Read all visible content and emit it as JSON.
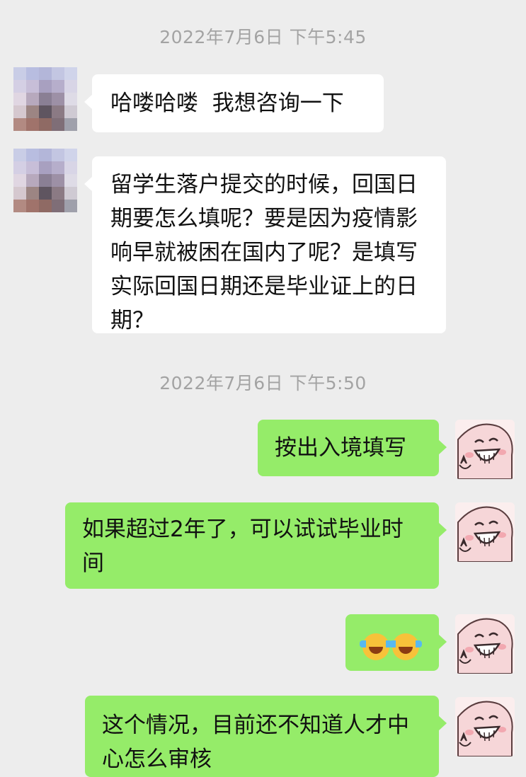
{
  "chat": {
    "timestamps": [
      "2022年7月6日 下午5:45",
      "2022年7月6日 下午5:50"
    ],
    "messages": [
      {
        "from": "contact",
        "text": "哈喽哈喽  我想咨询一下"
      },
      {
        "from": "contact",
        "text": "留学生落户提交的时候，回国日期要怎么填呢？要是因为疫情影响早就被困在国内了呢？是填写实际回国日期还是毕业证上的日期？"
      },
      {
        "from": "me",
        "text": "按出入境填写"
      },
      {
        "from": "me",
        "text": "如果超过2年了，可以试试毕业时间"
      },
      {
        "from": "me",
        "emoji": [
          "loudly-crying-face-emoji",
          "loudly-crying-face-emoji"
        ]
      },
      {
        "from": "me",
        "text": "这个情况，目前还不知道人才中心怎么审核"
      }
    ]
  },
  "colors": {
    "background": "#ededed",
    "incoming_bubble": "#ffffff",
    "outgoing_bubble": "#95ec69",
    "timestamp_text": "#a3a3a3"
  }
}
